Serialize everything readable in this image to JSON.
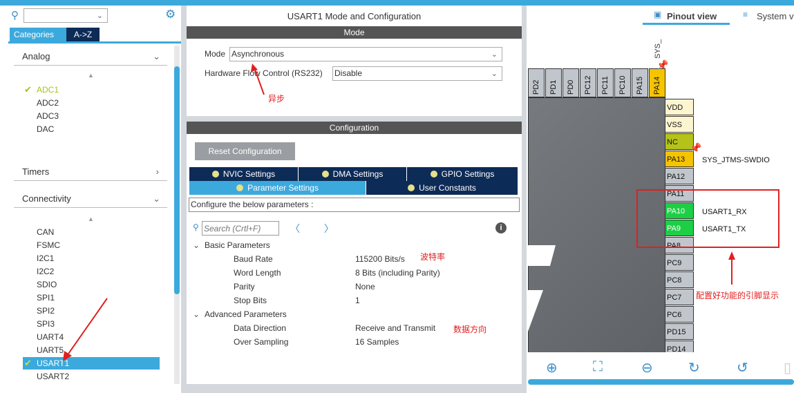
{
  "left": {
    "search_value": "",
    "tabs": [
      "Categories",
      "A->Z"
    ],
    "categories": {
      "analog": "Analog",
      "timers": "Timers",
      "connectivity": "Connectivity"
    },
    "analog_items": [
      "ADC1",
      "ADC2",
      "ADC3",
      "DAC"
    ],
    "connectivity_items": [
      "CAN",
      "FSMC",
      "I2C1",
      "I2C2",
      "SDIO",
      "SPI1",
      "SPI2",
      "SPI3",
      "UART4",
      "UART5",
      "USART1",
      "USART2"
    ]
  },
  "middle": {
    "title": "USART1 Mode and Configuration",
    "mode_header": "Mode",
    "mode_label": "Mode",
    "mode_value": "Asynchronous",
    "flow_label": "Hardware Flow Control (RS232)",
    "flow_value": "Disable",
    "config_header": "Configuration",
    "reset_label": "Reset Configuration",
    "tabs": [
      "NVIC Settings",
      "DMA Settings",
      "GPIO Settings",
      "Parameter Settings",
      "User Constants"
    ],
    "configure_text": "Configure the below parameters :",
    "search_placeholder": "Search (Crtl+F)",
    "groups": [
      {
        "name": "Basic Parameters",
        "params": [
          {
            "k": "Baud Rate",
            "v": "115200 Bits/s"
          },
          {
            "k": "Word Length",
            "v": "8 Bits (including Parity)"
          },
          {
            "k": "Parity",
            "v": "None"
          },
          {
            "k": "Stop Bits",
            "v": "1"
          }
        ]
      },
      {
        "name": "Advanced Parameters",
        "params": [
          {
            "k": "Data Direction",
            "v": "Receive and Transmit"
          },
          {
            "k": "Over Sampling",
            "v": "16 Samples"
          }
        ]
      }
    ]
  },
  "annotations": {
    "async": "异步",
    "baud": "波特率",
    "direction": "数据方向",
    "pins": "配置好功能的引脚显示"
  },
  "right": {
    "tabs": [
      "Pinout view",
      "System v"
    ],
    "top_pins": [
      "PD2",
      "PD1",
      "PD0",
      "PC12",
      "PC11",
      "PC10",
      "PA15",
      "PA14"
    ],
    "top_label": "SYS_",
    "side_pins": [
      "VDD",
      "VSS",
      "NC",
      "PA13",
      "PA12",
      "PA11",
      "PA10",
      "PA9",
      "PA8",
      "PC9",
      "PC8",
      "PC7",
      "PC6",
      "PD15",
      "PD14"
    ],
    "pin_labels": {
      "PA13": "SYS_JTMS-SWDIO",
      "PA10": "USART1_RX",
      "PA9": "USART1_TX"
    }
  }
}
